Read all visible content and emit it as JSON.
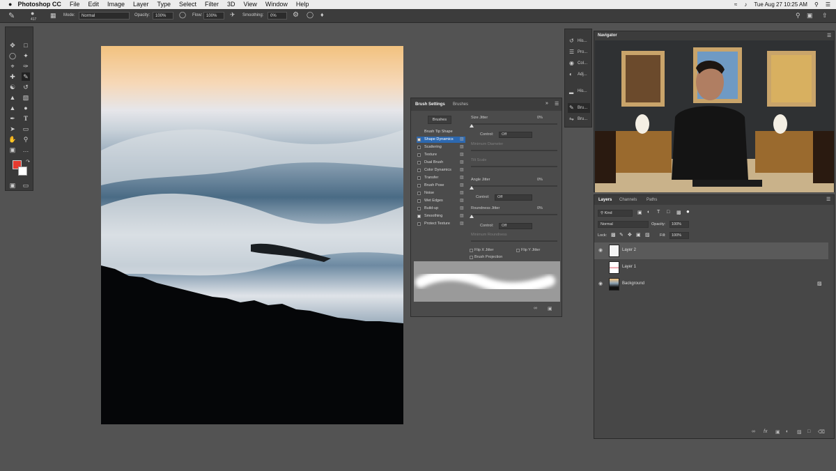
{
  "menubar": {
    "apple": "",
    "app": "Photoshop CC",
    "items": [
      "File",
      "Edit",
      "Image",
      "Layer",
      "Type",
      "Select",
      "Filter",
      "3D",
      "View",
      "Window",
      "Help"
    ],
    "datetime": "Tue Aug 27  10:25 AM"
  },
  "options": {
    "brush_size": "417",
    "mode_label": "Mode:",
    "mode_value": "Normal",
    "opacity_label": "Opacity:",
    "opacity_value": "100%",
    "flow_label": "Flow:",
    "flow_value": "100%",
    "smoothing_label": "Smoothing:",
    "smoothing_value": "0%"
  },
  "brush_settings": {
    "tabs": [
      "Brush Settings",
      "Brushes"
    ],
    "brushes_button": "Brushes",
    "items": [
      {
        "label": "Brush Tip Shape",
        "checkbox": false,
        "checked": false,
        "selected": false
      },
      {
        "label": "Shape Dynamics",
        "checkbox": true,
        "checked": true,
        "selected": true
      },
      {
        "label": "Scattering",
        "checkbox": true,
        "checked": false,
        "selected": false
      },
      {
        "label": "Texture",
        "checkbox": true,
        "checked": false,
        "selected": false
      },
      {
        "label": "Dual Brush",
        "checkbox": true,
        "checked": false,
        "selected": false
      },
      {
        "label": "Color Dynamics",
        "checkbox": true,
        "checked": false,
        "selected": false
      },
      {
        "label": "Transfer",
        "checkbox": true,
        "checked": false,
        "selected": false
      },
      {
        "label": "Brush Pose",
        "checkbox": true,
        "checked": false,
        "selected": false
      },
      {
        "label": "Noise",
        "checkbox": true,
        "checked": false,
        "selected": false
      },
      {
        "label": "Wet Edges",
        "checkbox": true,
        "checked": false,
        "selected": false
      },
      {
        "label": "Build-up",
        "checkbox": true,
        "checked": false,
        "selected": false
      },
      {
        "label": "Smoothing",
        "checkbox": true,
        "checked": true,
        "selected": false
      },
      {
        "label": "Protect Texture",
        "checkbox": true,
        "checked": false,
        "selected": false
      }
    ],
    "size_jitter_label": "Size Jitter",
    "size_jitter_value": "0%",
    "control_label": "Control:",
    "control_value": "Off",
    "min_diameter_label": "Minimum Diameter",
    "tilt_scale_label": "Tilt Scale",
    "angle_jitter_label": "Angle Jitter",
    "angle_jitter_value": "0%",
    "roundness_jitter_label": "Roundness Jitter",
    "roundness_jitter_value": "0%",
    "min_roundness_label": "Minimum Roundness",
    "flip_x": "Flip X Jitter",
    "flip_y": "Flip Y Jitter",
    "brush_projection": "Brush Projection"
  },
  "dock": {
    "items": [
      "His...",
      "Pro...",
      "Col...",
      "Adj...",
      "His...",
      "Bru...",
      "Bru..."
    ]
  },
  "navigator": {
    "title": "Navigator"
  },
  "layers": {
    "tabs": [
      "Layers",
      "Channels",
      "Paths"
    ],
    "kind_label": "Kind",
    "blend_mode": "Normal",
    "opacity_label": "Opacity:",
    "opacity_value": "100%",
    "lock_label": "Lock:",
    "fill_label": "Fill:",
    "fill_value": "100%",
    "rows": [
      {
        "name": "Layer 2",
        "visible": true,
        "selected": true
      },
      {
        "name": "Layer 1",
        "visible": false,
        "selected": false
      },
      {
        "name": "Background",
        "visible": true,
        "selected": false
      }
    ]
  },
  "colors": {
    "foreground": "#e53a2f",
    "background": "#ffffff",
    "accent": "#2c68b0"
  }
}
